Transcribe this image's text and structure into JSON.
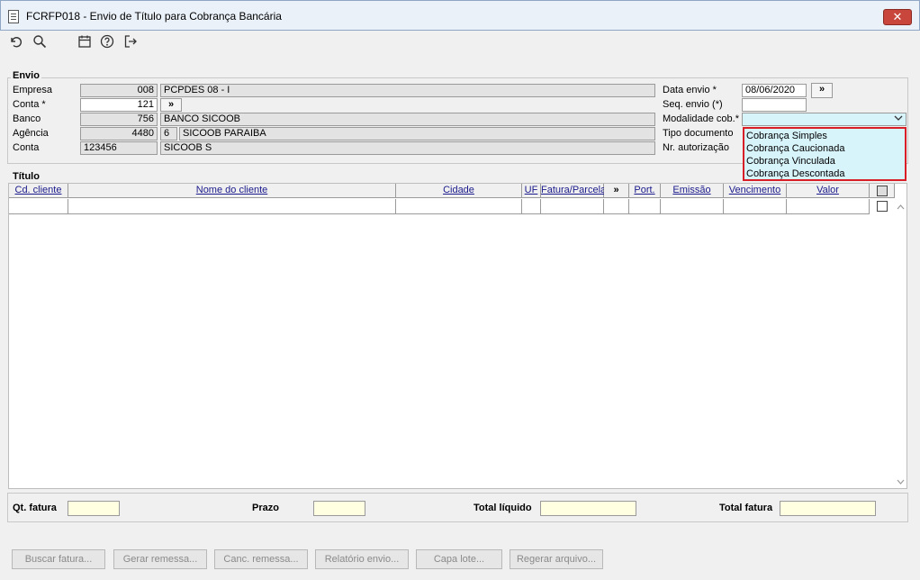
{
  "window": {
    "title": "FCRFP018 - Envio de Título para Cobrança Bancária",
    "close_label": "✕"
  },
  "toolbar": {
    "icons": [
      "undo-icon",
      "search-icon",
      "calendar-icon",
      "help-icon",
      "exit-icon"
    ]
  },
  "envio": {
    "group_label": "Envio",
    "empresa": {
      "label": "Empresa",
      "code": "008",
      "name": "PCPDES 08 - I"
    },
    "conta": {
      "label": "Conta *",
      "code": "121",
      "btn": "»"
    },
    "banco": {
      "label": "Banco",
      "code": "756",
      "name": "BANCO SICOOB"
    },
    "agencia": {
      "label": "Agência",
      "code": "4480",
      "digit": "6",
      "name": "SICOOB PARAIBA"
    },
    "conta2": {
      "label": "Conta",
      "code": "123456",
      "name": "SICOOB S"
    },
    "data_envio": {
      "label": "Data envio *",
      "value": "08/06/2020",
      "btn": "»"
    },
    "seq_envio": {
      "label": "Seq. envio (*)",
      "value": ""
    },
    "modalidade": {
      "label": "Modalidade cob.*",
      "value": "",
      "options": [
        "Cobrança Simples",
        "Cobrança Caucionada",
        "Cobrança Vinculada",
        "Cobrança Descontada"
      ]
    },
    "tipo_documento": {
      "label": "Tipo documento"
    },
    "nr_autorizacao": {
      "label": "Nr. autorização"
    }
  },
  "titulo": {
    "group_label": "Título",
    "columns": [
      "Cd. cliente",
      "Nome do cliente",
      "Cidade",
      "UF",
      "Fatura/Parcela",
      "»",
      "Port.",
      "Emissão",
      "Vencimento",
      "Valor"
    ]
  },
  "footer": {
    "qt_fatura": "Qt. fatura",
    "prazo": "Prazo",
    "total_liquido": "Total líquido",
    "total_fatura": "Total fatura"
  },
  "buttons": [
    "Buscar fatura...",
    "Gerar remessa...",
    "Canc. remessa...",
    "Relatório envio...",
    "Capa lote...",
    "Regerar arquivo..."
  ],
  "colors": {
    "dropdown_bg": "#d8f4fb",
    "dropdown_border": "#d81e26",
    "footer_field_bg": "#ffffe1"
  }
}
